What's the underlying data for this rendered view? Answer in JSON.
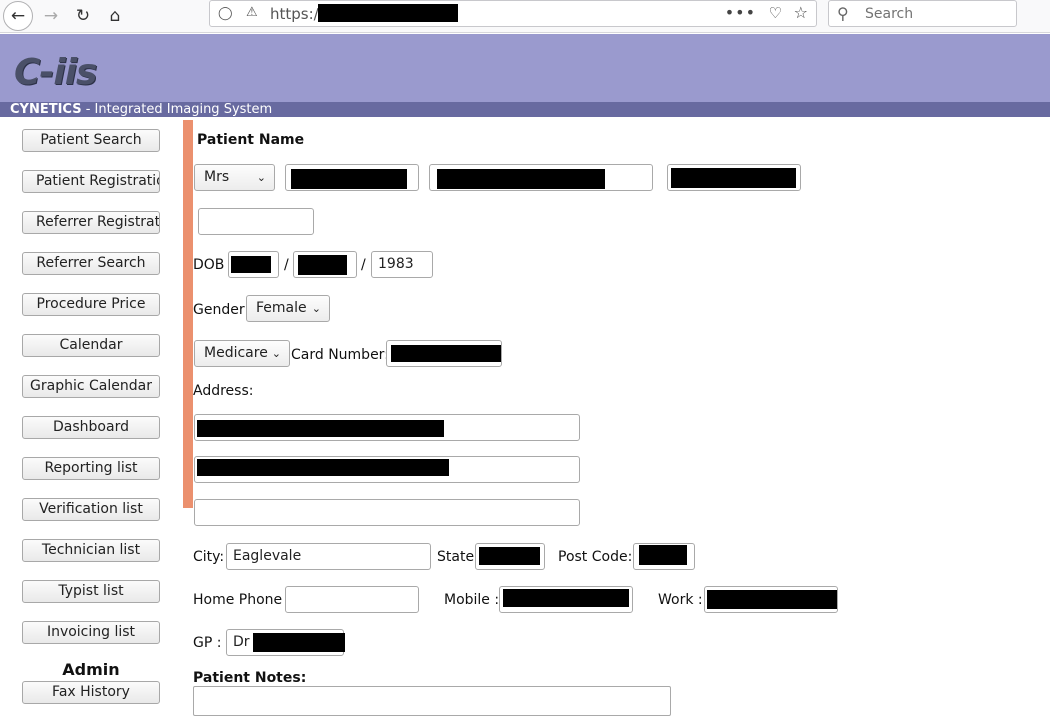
{
  "browser": {
    "url_prefix": "https://",
    "search_placeholder": "Search"
  },
  "app": {
    "logo": "C-iis",
    "brand": "CYNETICS",
    "tagline": " - Integrated Imaging System"
  },
  "sidebar": {
    "items": [
      "Patient Search",
      "Patient Registration",
      "Referrer Registration",
      "Referrer Search",
      "Procedure Price",
      "Calendar",
      "Graphic Calendar",
      "Dashboard",
      "Reporting list",
      "Verification list",
      "Technician list",
      "Typist list",
      "Invoicing list"
    ],
    "admin_title": "Admin",
    "admin_items": [
      "Fax History"
    ]
  },
  "form": {
    "patient_name_label": "Patient Name",
    "title_select": "Mrs",
    "dob_label": "DOB",
    "dob_sep": "/",
    "dob_year": "1983",
    "gender_label": "Gender",
    "gender_select": "Female",
    "card_type_select": "Medicare",
    "card_number_label": "Card Number:",
    "address_label": "Address:",
    "city_label": "City:",
    "city_value": "Eaglevale",
    "state_label": "State",
    "postcode_label": "Post Code:",
    "home_phone_label": "Home Phone :",
    "mobile_label": "Mobile :",
    "work_label": "Work :",
    "gp_label": "GP :",
    "gp_value": "Dr",
    "notes_label": "Patient Notes:"
  },
  "colors": {
    "header_bg": "#9a9ace",
    "subbar_bg": "#686aa0",
    "accent_bar": "#eb906e"
  }
}
